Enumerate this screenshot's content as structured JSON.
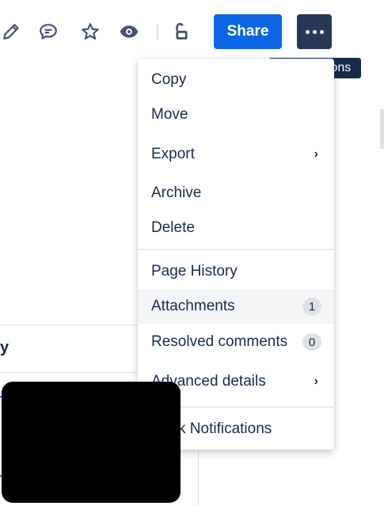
{
  "toolbar": {
    "icons": [
      "pencil-icon",
      "comment-icon",
      "star-icon",
      "eye-icon",
      "unlock-icon"
    ],
    "share_label": "Share",
    "more_tooltip": "More actions"
  },
  "background": {
    "panel_heading": "y"
  },
  "menu": {
    "items": [
      {
        "label": "Copy"
      },
      {
        "label": "Move"
      },
      {
        "label": "Export"
      },
      {
        "label": "Archive"
      },
      {
        "label": "Delete"
      },
      {
        "label": "Page History"
      },
      {
        "label": "Attachments",
        "badge": "1"
      },
      {
        "label": "Resolved comments",
        "badge": "0"
      },
      {
        "label": "Advanced details"
      },
      {
        "label": "k Notifications"
      }
    ]
  },
  "colors": {
    "primary": "#0c66e4",
    "more_button": "#253858",
    "text": "#172b4d"
  }
}
